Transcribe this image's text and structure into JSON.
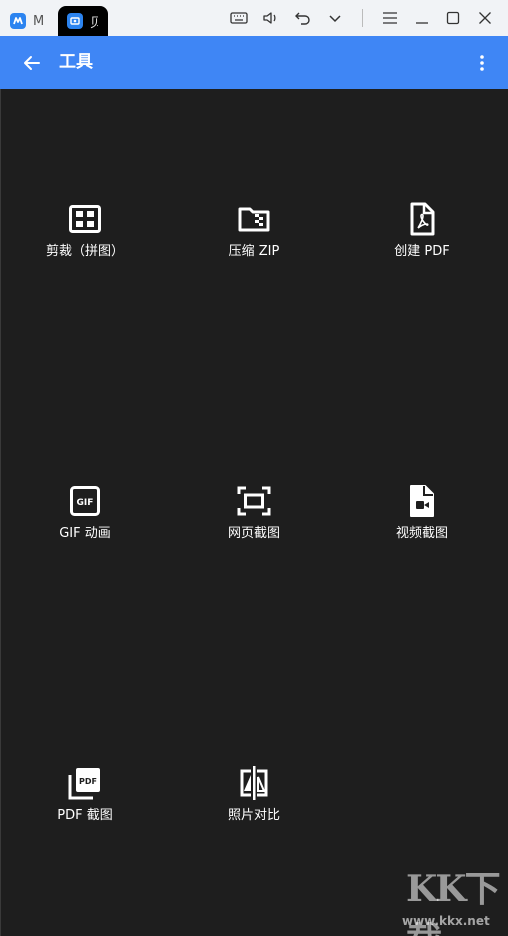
{
  "window": {
    "tab1_label": "M",
    "tab2_label": "贝",
    "controls": [
      "keyboard-icon",
      "volume-icon",
      "undo-icon",
      "chevron-down-icon",
      "menu-icon",
      "minimize-icon",
      "maximize-icon",
      "close-icon"
    ]
  },
  "appbar": {
    "title": "工具",
    "color": "#3f86f5"
  },
  "tools": [
    {
      "label": "剪裁（拼图）",
      "icon": "grid-crop-icon"
    },
    {
      "label": "压缩 ZIP",
      "icon": "zip-folder-icon"
    },
    {
      "label": "创建 PDF",
      "icon": "pdf-file-icon"
    },
    {
      "label": "GIF 动画",
      "icon": "gif-icon"
    },
    {
      "label": "网页截图",
      "icon": "webpage-capture-icon"
    },
    {
      "label": "视频截图",
      "icon": "video-file-icon"
    },
    {
      "label": "PDF 截图",
      "icon": "pdf-stack-icon"
    },
    {
      "label": "照片对比",
      "icon": "compare-icon"
    }
  ],
  "watermark": {
    "text": "KK下载",
    "url": "www.kkx.net"
  }
}
